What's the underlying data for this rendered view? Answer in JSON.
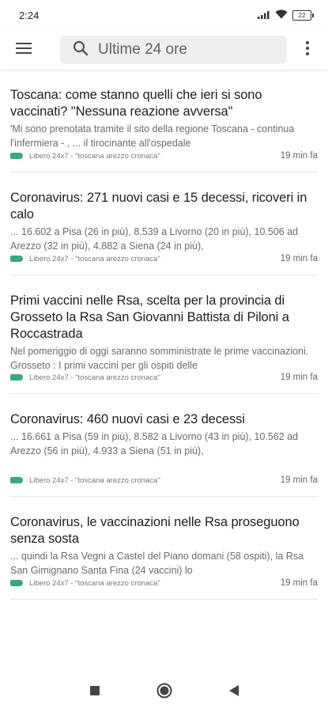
{
  "status_bar": {
    "time": "2:24",
    "battery": "22"
  },
  "search": {
    "query": "Ultime 24 ore"
  },
  "articles": [
    {
      "title": "Toscana: come stanno quelli che ieri si sono vaccinati? \"Nessuna reazione avversa\"",
      "snippet": "'Mi sono prenotata tramite il sito della regione Toscana - continua l'infermiera - , ... il tirocinante all'ospedale",
      "source": "Libero 24x7 - \"toscana arezzo cronaca\"",
      "time": "19 min fa"
    },
    {
      "title": "Coronavirus: 271 nuovi casi e 15 decessi, ricoveri in calo",
      "snippet": "... 16.602 a Pisa (26 in più), 8.539 a Livorno (20 in più), 10.506 ad Arezzo (32 in più), 4.882 a Siena (24 in più),",
      "source": "Libero 24x7 - \"toscana arezzo cronaca\"",
      "time": "19 min fa"
    },
    {
      "title": "Primi vaccini nelle Rsa, scelta per la provincia di Grosseto la Rsa San Giovanni Battista di Piloni a Roccastrada",
      "snippet": "Nel pomeriggio di oggi saranno somministrate le prime vaccinazioni. Grosseto : I primi vaccini per gli ospiti delle",
      "source": "Libero 24x7 - \"toscana arezzo cronaca\"",
      "time": "19 min fa"
    },
    {
      "title": "Coronavirus: 460 nuovi casi e 23 decessi",
      "snippet": "... 16.661 a Pisa (59 in più), 8.582 a Livorno (43 in più), 10.562 ad Arezzo (56 in più), 4.933 a Siena (51 in più),",
      "source": "Libero 24x7 - \"toscana arezzo cronaca\"",
      "time": "19 min fa"
    },
    {
      "title": "Coronavirus, le vaccinazioni nelle Rsa proseguono senza sosta",
      "snippet": "... quindi la Rsa Vegni a Castel del Piano domani (58 ospiti), la Rsa San Gimignano Santa Fina (24 vaccini) lo",
      "source": "Libero 24x7 - \"toscana arezzo cronaca\"",
      "time": "19 min fa"
    }
  ],
  "colors": {
    "tag": "#39a87a",
    "search_bg": "#eeeeee"
  }
}
